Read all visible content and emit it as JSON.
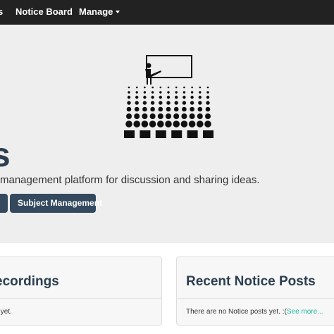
{
  "navbar": {
    "partial_item": "s",
    "notice_board": "Notice Board",
    "manage": "Manage"
  },
  "hero": {
    "illustration_icon": "lecture-hall-icon",
    "title_fragment": "s",
    "tagline": "management platform for discussion and sharing ideas.",
    "subject_management_button": "Subject Management"
  },
  "panels": {
    "recordings": {
      "title_fragment": "ecordings",
      "text_fragment": "s yet."
    },
    "notices": {
      "title": "Recent Notice Posts",
      "text": "There are no Notice posts yet. :(",
      "link": "See more..."
    }
  },
  "colors": {
    "navbar_bg": "#222222",
    "jumbotron_bg": "#eeeeee",
    "primary": "#2c3e50",
    "button_bg": "#34495e",
    "link": "#18bc9c"
  }
}
